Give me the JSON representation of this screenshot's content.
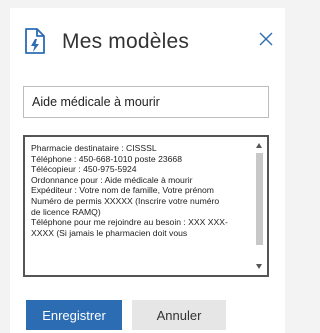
{
  "dialog": {
    "title": "Mes modèles",
    "icons": {
      "header": "document-lightning-icon",
      "close": "close-icon"
    },
    "accent_color": "#2b6cb3",
    "template_name": "Aide médicale à mourir",
    "body_lines": [
      "Pharmacie destinataire : CISSSL",
      "Téléphone : 450-668-1010 poste 23668",
      "Télécopieur : 450-975-5924",
      "Ordonnance pour : Aide médicale à mourir",
      "Expéditeur : Votre nom de famille, Votre prénom",
      "Numéro de permis XXXXX (Inscrire votre numéro",
      "de licence RAMQ)",
      "Téléphone pour me rejoindre au besoin : XXX XXX-",
      "XXXX (Si jamais le pharmacien doit vous"
    ],
    "save_label": "Enregistrer",
    "cancel_label": "Annuler"
  }
}
